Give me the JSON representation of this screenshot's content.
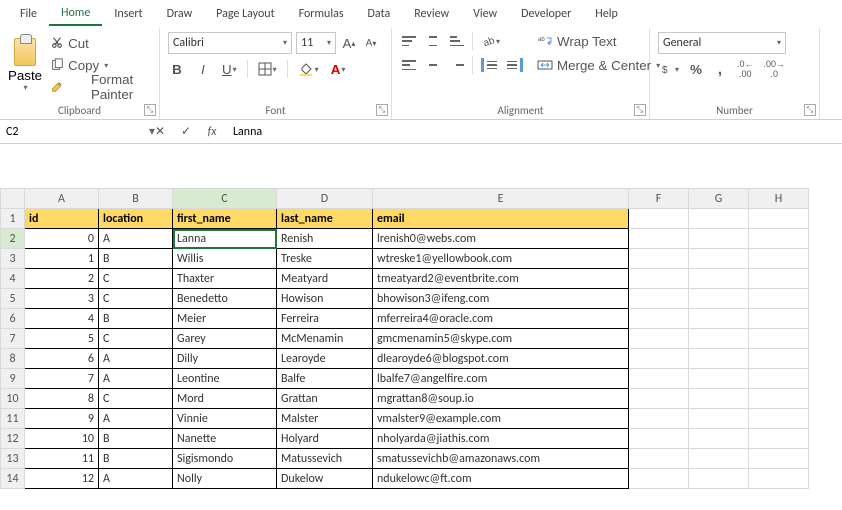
{
  "tabs": [
    "File",
    "Home",
    "Insert",
    "Draw",
    "Page Layout",
    "Formulas",
    "Data",
    "Review",
    "View",
    "Developer",
    "Help"
  ],
  "active_tab": "Home",
  "clipboard": {
    "paste": "Paste",
    "cut": "Cut",
    "copy": "Copy",
    "fmt": "Format Painter",
    "group": "Clipboard"
  },
  "font": {
    "name": "Calibri",
    "size": "11",
    "group": "Font",
    "bold": "B",
    "italic": "I",
    "underline": "U"
  },
  "alignment": {
    "wrap": "Wrap Text",
    "merge": "Merge & Center",
    "group": "Alignment"
  },
  "number": {
    "fmt": "General",
    "group": "Number"
  },
  "namebox": "C2",
  "formula": "Lanna",
  "columns": [
    "A",
    "B",
    "C",
    "D",
    "E",
    "F",
    "G",
    "H"
  ],
  "header": [
    "id",
    "location",
    "first_name",
    "last_name",
    "email"
  ],
  "rows": [
    [
      "0",
      "A",
      "Lanna",
      "Renish",
      "lrenish0@webs.com"
    ],
    [
      "1",
      "B",
      "Willis",
      "Treske",
      "wtreske1@yellowbook.com"
    ],
    [
      "2",
      "C",
      "Thaxter",
      "Meatyard",
      "tmeatyard2@eventbrite.com"
    ],
    [
      "3",
      "C",
      "Benedetto",
      "Howison",
      "bhowison3@ifeng.com"
    ],
    [
      "4",
      "B",
      "Meier",
      "Ferreira",
      "mferreira4@oracle.com"
    ],
    [
      "5",
      "C",
      "Garey",
      "McMenamin",
      "gmcmenamin5@skype.com"
    ],
    [
      "6",
      "A",
      "Dilly",
      "Learoyde",
      "dlearoyde6@blogspot.com"
    ],
    [
      "7",
      "A",
      "Leontine",
      "Balfe",
      "lbalfe7@angelfire.com"
    ],
    [
      "8",
      "C",
      "Mord",
      "Grattan",
      "mgrattan8@soup.io"
    ],
    [
      "9",
      "A",
      "Vinnie",
      "Malster",
      "vmalster9@example.com"
    ],
    [
      "10",
      "B",
      "Nanette",
      "Holyard",
      "nholyarda@jiathis.com"
    ],
    [
      "11",
      "B",
      "Sigismondo",
      "Matussevich",
      "smatussevichb@amazonaws.com"
    ],
    [
      "12",
      "A",
      "Nolly",
      "Dukelow",
      "ndukelowc@ft.com"
    ]
  ],
  "active_cell": {
    "row": 2,
    "col": "C"
  }
}
